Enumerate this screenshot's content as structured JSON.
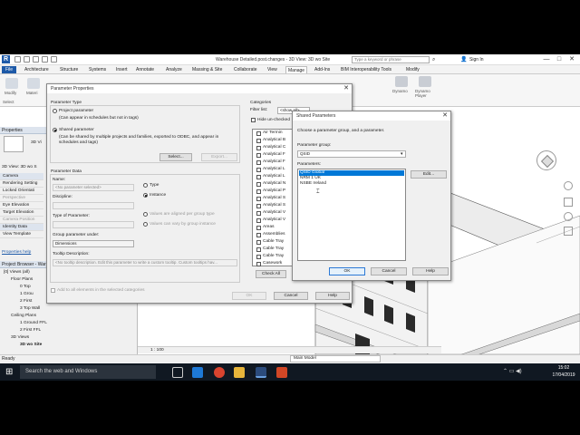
{
  "app": {
    "title": "Warehouse Detailed.post.changes - 3D View: 3D wo Site",
    "search_placeholder": "Type a keyword or phrase",
    "sign_in": "Sign In",
    "logo": "R",
    "minimize": "—",
    "maximize": "□",
    "close": "✕"
  },
  "ribbon": {
    "tabs": [
      "File",
      "Architecture",
      "Structure",
      "Systems",
      "Insert",
      "Annotate",
      "Analyze",
      "Massing & Site",
      "Collaborate",
      "View",
      "Manage",
      "Add-Ins",
      "BIM Interoperability Tools",
      "Modify"
    ],
    "active_tab": "Manage",
    "left_tools": [
      "Modify",
      "Materi"
    ],
    "right_tools": [
      "Dynamo",
      "Dynamo Player"
    ],
    "select_label": "Select"
  },
  "properties": {
    "header": "Properties",
    "type_label": "3D Vi",
    "view_selector": "3D View: 3D wo S",
    "rows": [
      "Camera",
      "Rendering Setting",
      "Locked Orientati",
      "Perspective",
      "Eye Elevation",
      "Target Elevation",
      "Camera Position",
      "Identity Data",
      "View Template"
    ],
    "help_link": "Properties help"
  },
  "project_browser": {
    "header": "Project Browser - Ware",
    "items": [
      "[0] Views (all)",
      "Floor Plans",
      "0 Top",
      "1 Grou",
      "2 First",
      "3 Top Wall",
      "Ceiling Plans",
      "1 Ground FFL",
      "2 First FFL",
      "3D Views",
      "3D wo Site"
    ]
  },
  "parameter_properties": {
    "title": "Parameter Properties",
    "parameter_type_label": "Parameter Type",
    "project_param": "Project parameter",
    "project_param_desc": "(Can appear in schedules but not in tags)",
    "shared_param": "Shared parameter",
    "shared_param_desc": "(Can be shared by multiple projects and families, exported to ODBC, and appear in schedules and tags)",
    "select_button": "Select...",
    "export_button": "Export...",
    "parameter_data_label": "Parameter Data",
    "name_label": "Name:",
    "name_value": "<No parameter selected>",
    "discipline_label": "Discipline:",
    "type_of_param_label": "Type of Parameter:",
    "group_under_label": "Group parameter under:",
    "group_under_value": "Dimensions",
    "tooltip_label": "Tooltip Description:",
    "tooltip_value": "<No tooltip description. Edit this parameter to write a custom tooltip. Custom tooltips hav...",
    "type_radio": "Type",
    "instance_radio": "Instance",
    "aligned_radio": "Values are aligned per group type",
    "vary_radio": "Values can vary by group instance",
    "add_all_elements": "Add to all elements in the selected categories",
    "ok": "OK",
    "cancel": "Cancel",
    "help": "Help",
    "categories_label": "Categories",
    "filter_label": "Filter list:",
    "filter_value": "<show all>",
    "hide_unchecked": "Hide un-checked",
    "category_items": [
      "Air Termin",
      "Analytical B",
      "Analytical C",
      "Analytical F",
      "Analytical F",
      "Analytical L",
      "Analytical L",
      "Analytical N",
      "Analytical P",
      "Analytical S",
      "Analytical S",
      "Analytical V",
      "Analytical V",
      "Areas",
      "Assemblies",
      "Cable Tray",
      "Cable Tray",
      "Cable Tray",
      "Casework"
    ],
    "check_all": "Check All"
  },
  "shared_parameters": {
    "title": "Shared Parameters",
    "instruction": "Choose a parameter group, and a parameter.",
    "group_label": "Parameter group:",
    "group_value": "QSID",
    "parameters_label": "Parameters:",
    "parameters": [
      "QSID Global",
      "NRM 1 UK",
      "NSBE Ireland"
    ],
    "selected": "QSID Global",
    "edit_button": "Edit...",
    "ok": "OK",
    "cancel": "Cancel",
    "help": "Help"
  },
  "status": {
    "text": "Ready",
    "scale": "1 : 100",
    "model": "Main Model"
  },
  "taskbar": {
    "search": "Search the web and Windows",
    "time": "15:02",
    "date": "17/04/2019"
  },
  "colors": {
    "accent": "#0078d7",
    "file_tab": "#1e5aa8",
    "taskbar": "#101822",
    "building_wall": "#f2f2f2",
    "window": "#2a2a2a"
  }
}
